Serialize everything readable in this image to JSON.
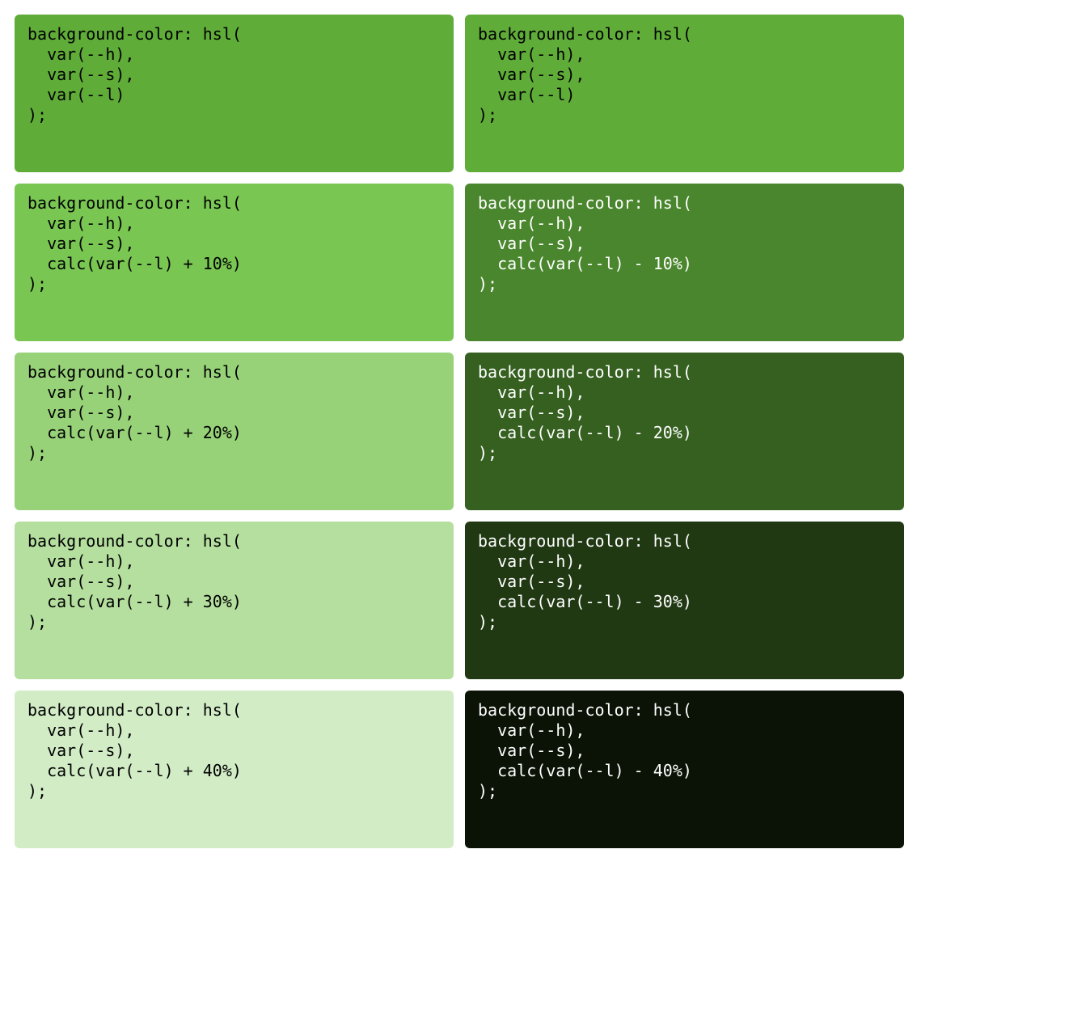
{
  "hsl_base": {
    "h": 100,
    "s": "50%",
    "l": "45%"
  },
  "swatches": [
    {
      "delta": 0,
      "light_text_class": "",
      "dark_text_class": "",
      "code_left": "background-color: hsl(\n  var(--h),\n  var(--s),\n  var(--l)\n);",
      "code_right": "background-color: hsl(\n  var(--h),\n  var(--s),\n  var(--l)\n);"
    },
    {
      "delta": 10,
      "light_text_class": "",
      "dark_text_class": "dark",
      "code_left": "background-color: hsl(\n  var(--h),\n  var(--s),\n  calc(var(--l) + 10%)\n);",
      "code_right": "background-color: hsl(\n  var(--h),\n  var(--s),\n  calc(var(--l) - 10%)\n);"
    },
    {
      "delta": 20,
      "light_text_class": "",
      "dark_text_class": "dark",
      "code_left": "background-color: hsl(\n  var(--h),\n  var(--s),\n  calc(var(--l) + 20%)\n);",
      "code_right": "background-color: hsl(\n  var(--h),\n  var(--s),\n  calc(var(--l) - 20%)\n);"
    },
    {
      "delta": 30,
      "light_text_class": "",
      "dark_text_class": "dark",
      "code_left": "background-color: hsl(\n  var(--h),\n  var(--s),\n  calc(var(--l) + 30%)\n);",
      "code_right": "background-color: hsl(\n  var(--h),\n  var(--s),\n  calc(var(--l) - 30%)\n);"
    },
    {
      "delta": 40,
      "light_text_class": "",
      "dark_text_class": "dark",
      "code_left": "background-color: hsl(\n  var(--h),\n  var(--s),\n  calc(var(--l) + 40%)\n);",
      "code_right": "background-color: hsl(\n  var(--h),\n  var(--s),\n  calc(var(--l) - 40%)\n);"
    }
  ]
}
